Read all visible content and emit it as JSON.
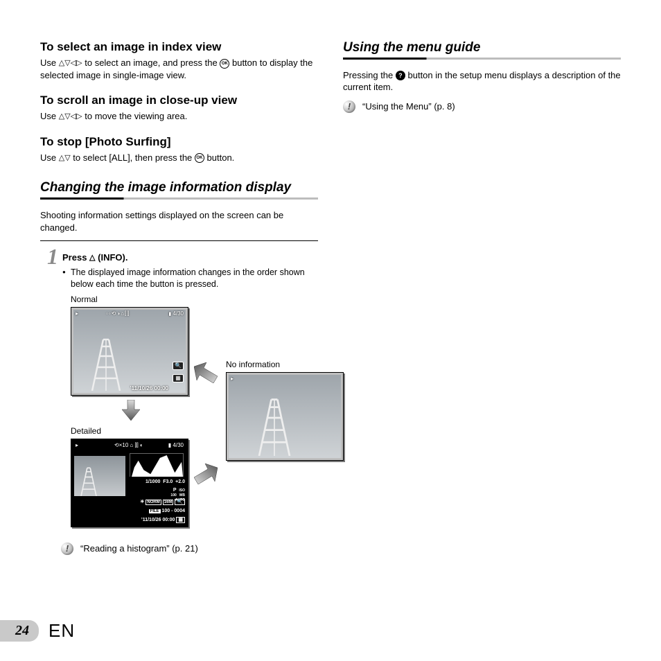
{
  "left": {
    "sub1": {
      "title": "To select an image in index view",
      "body_a": "Use ",
      "body_b": " to select an image, and press the ",
      "body_c": " button to display the selected image in single-image view."
    },
    "sub2": {
      "title": "To scroll an image in close-up view",
      "body_a": "Use ",
      "body_b": " to move the viewing area."
    },
    "sub3": {
      "title": "To stop [Photo Surfing]",
      "body_a": "Use ",
      "body_b": " to select [ALL], then press the ",
      "body_c": " button."
    },
    "section": "Changing the image information display",
    "intro": "Shooting information settings displayed on the screen can be changed.",
    "step1": {
      "num": "1",
      "title_a": "Press ",
      "title_b": " (INFO).",
      "bullet": "The displayed image information changes in the order shown below each time the button is pressed."
    },
    "captions": {
      "normal": "Normal",
      "detailed": "Detailed",
      "noinfo": "No information"
    },
    "lcd_normal": {
      "date": "’11/10/26 00:00",
      "counter": "4/30"
    },
    "lcd_detailed": {
      "counter": "4/30",
      "shutter": "1/1000",
      "fnum": "F3.0",
      "ev": "+2.0",
      "mode": "P",
      "iso_lbl": "ISO",
      "iso_val": "100",
      "wb_lbl": "WB",
      "wb_val": "AUTO",
      "qual": "NORM",
      "size": "16M",
      "file_lbl": "FILE",
      "file_val": "100 - 0004",
      "date": "’11/10/26 00:00",
      "icons": "×10"
    },
    "note": "“Reading a histogram” (p. 21)"
  },
  "right": {
    "section": "Using the menu guide",
    "para_a": "Pressing the ",
    "para_b": " button in the setup menu displays a description of the current item.",
    "note": "“Using the Menu” (p. 8)"
  },
  "footer": {
    "page": "24",
    "lang": "EN"
  },
  "glyph": {
    "ok": "OK",
    "q": "?",
    "up": "△",
    "down": "▽",
    "left": "◁",
    "right": "▷"
  }
}
